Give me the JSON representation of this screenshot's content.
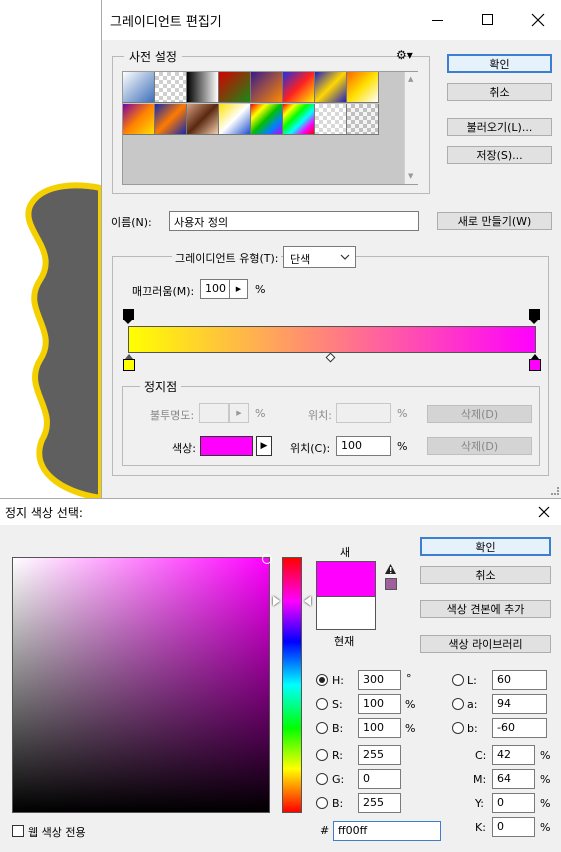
{
  "gradient_editor": {
    "title": "그레이디언트 편집기",
    "presets_legend": "사전 설정",
    "buttons": {
      "ok": "확인",
      "cancel": "취소",
      "load": "불러오기(L)...",
      "save": "저장(S)...",
      "new": "새로 만들기(W)"
    },
    "name_label": "이름(N):",
    "name_value": "사용자 정의",
    "type_label": "그레이디언트 유형(T):",
    "type_value": "단색",
    "smoothness_label": "매끄러움(M):",
    "smoothness_value": "100",
    "smoothness_unit": "%",
    "stops": {
      "legend": "정지점",
      "opacity_label": "불투명도:",
      "opacity_unit": "%",
      "location_label": "위치:",
      "location_unit": "%",
      "delete_label": "삭제(D)",
      "color_label": "색상:",
      "color_location_label": "위치(C):",
      "color_location_value": "100",
      "color_location_unit": "%",
      "color_value": "#ff00ff"
    },
    "gradient_colors": [
      "#ffff00",
      "#ff00ff"
    ],
    "preset_swatches": [
      "linear-gradient(135deg,#ffffff,#3d6fb8)",
      "repeating-conic-gradient(#cfcfcf 0 25%,#ffffff 0 50%) 0 0/8px 8px",
      "linear-gradient(90deg,#000000,#ffffff)",
      "linear-gradient(135deg,#d40000,#178a17)",
      "linear-gradient(135deg,#3a1a8c,#ff8a00)",
      "linear-gradient(135deg,#2030e0,#ff2020,#ffee00)",
      "linear-gradient(135deg,#2020c0,#ffd700,#2020c0)",
      "linear-gradient(135deg,#ff6600,#ffe000,#ffffff)",
      "linear-gradient(135deg,#7a00a8,#ff8000,#ffe000)",
      "linear-gradient(135deg,#1028b0,#ff7a00,#1028b0)",
      "linear-gradient(135deg,#d4a080,#5a2810,#f4d0b0)",
      "linear-gradient(135deg,#ffe000,#ffffff,#1c4fcf)",
      "linear-gradient(135deg,#ff0000,#ffff00,#00c000,#0080ff,#c000ff)",
      "linear-gradient(135deg,#ff0000,#ffff00,#00ff00,#00ffff,#ff00ff,#ff0000)",
      "repeating-conic-gradient(#d8d8d8 0 25%,#ffffff 0 50%) 0 0/8px 8px",
      "repeating-conic-gradient(#c0c0c0 0 25%,#f4f4f4 0 50%) 0 0/8px 8px"
    ]
  },
  "color_picker": {
    "title": "정지 색상 선택:",
    "buttons": {
      "ok": "확인",
      "cancel": "취소",
      "add_swatch": "색상 견본에 추가",
      "libraries": "색상 라이브러리"
    },
    "new_label": "새",
    "current_label": "현재",
    "new_color": "#ff00ff",
    "current_color": "#ffffff",
    "hue_color": "#ff00ff",
    "hsb": [
      {
        "label": "H:",
        "value": "300",
        "unit": "°",
        "selected": true
      },
      {
        "label": "S:",
        "value": "100",
        "unit": "%",
        "selected": false
      },
      {
        "label": "B:",
        "value": "100",
        "unit": "%",
        "selected": false
      }
    ],
    "rgb": [
      {
        "label": "R:",
        "value": "255"
      },
      {
        "label": "G:",
        "value": "0"
      },
      {
        "label": "B:",
        "value": "255"
      }
    ],
    "lab": [
      {
        "label": "L:",
        "value": "60"
      },
      {
        "label": "a:",
        "value": "94"
      },
      {
        "label": "b:",
        "value": "-60"
      }
    ],
    "cmyk": [
      {
        "label": "C:",
        "value": "42",
        "unit": "%"
      },
      {
        "label": "M:",
        "value": "64",
        "unit": "%"
      },
      {
        "label": "Y:",
        "value": "0",
        "unit": "%"
      },
      {
        "label": "K:",
        "value": "0",
        "unit": "%"
      }
    ],
    "hex_label": "#",
    "hex_value": "ff00ff",
    "web_only_label": "웹 색상 전용",
    "gamut_warning_color": "#a060a0"
  }
}
